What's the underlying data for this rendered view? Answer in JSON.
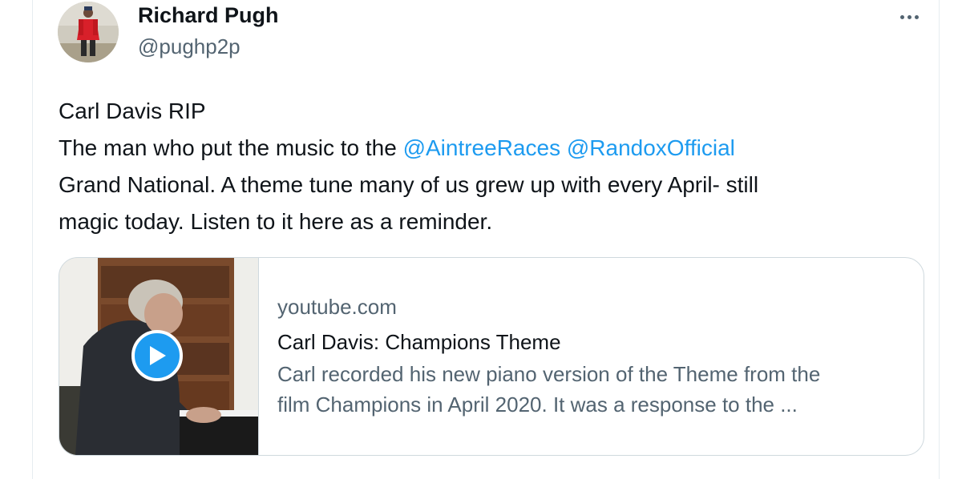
{
  "author": {
    "name": "Richard Pugh",
    "handle": "@pughp2p"
  },
  "more_icon": "more-horizontal-icon",
  "tweet": {
    "line1": "Carl Davis RIP",
    "line2_prefix": "The man who put the music to the ",
    "mention1": "@AintreeRaces",
    "mention_sep": " ",
    "mention2": "@RandoxOfficial",
    "line3": "Grand National. A theme tune many of us grew up with every April- still",
    "line4": "magic today. Listen to it here as a reminder."
  },
  "link_card": {
    "domain": "youtube.com",
    "title": "Carl Davis: Champions Theme",
    "description_line1": "Carl recorded his new piano version of the Theme from the",
    "description_line2": "film Champions in April 2020. It was a response to the ...",
    "play_icon": "play-icon"
  },
  "colors": {
    "accent": "#1d9bf0",
    "text": "#0f1419",
    "secondary": "#536471",
    "border": "#cfd9de"
  }
}
